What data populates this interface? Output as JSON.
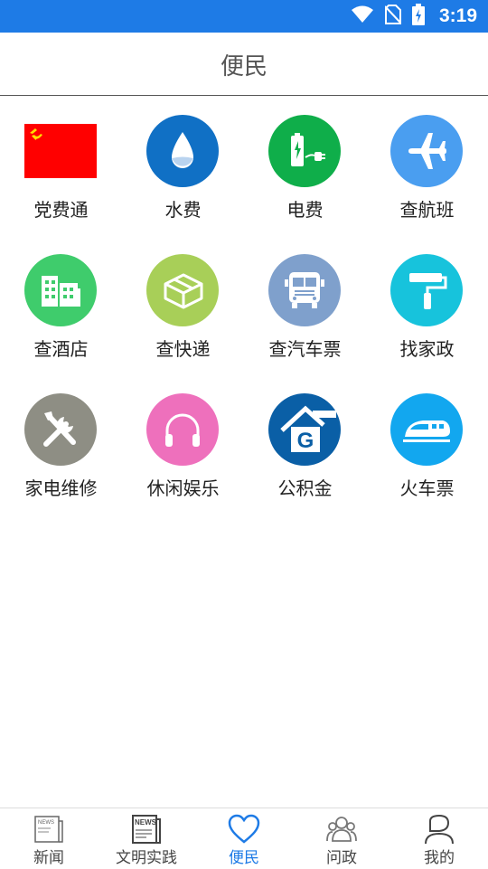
{
  "status_bar": {
    "time": "3:19",
    "background": "#1e7be6"
  },
  "header": {
    "title": "便民"
  },
  "services": [
    {
      "label": "党费通",
      "icon": "party-flag-icon",
      "color": "#ff0000"
    },
    {
      "label": "水费",
      "icon": "water-drop-icon",
      "color": "#1070c5"
    },
    {
      "label": "电费",
      "icon": "battery-plug-icon",
      "color": "#0fae4a"
    },
    {
      "label": "查航班",
      "icon": "airplane-icon",
      "color": "#4a9ef0"
    },
    {
      "label": "查酒店",
      "icon": "hotel-building-icon",
      "color": "#3fcc6c"
    },
    {
      "label": "查快递",
      "icon": "package-box-icon",
      "color": "#a8cf58"
    },
    {
      "label": "查汽车票",
      "icon": "bus-icon",
      "color": "#7fa0cc"
    },
    {
      "label": "找家政",
      "icon": "paint-roller-icon",
      "color": "#17c3dc"
    },
    {
      "label": "家电维修",
      "icon": "repair-tools-icon",
      "color": "#8e8e84"
    },
    {
      "label": "休闲娱乐",
      "icon": "headphones-icon",
      "color": "#ee70bc"
    },
    {
      "label": "公积金",
      "icon": "housing-fund-icon",
      "color": "#0a5fa6"
    },
    {
      "label": "火车票",
      "icon": "high-speed-train-icon",
      "color": "#12a7ef"
    }
  ],
  "tabs": [
    {
      "label": "新闻",
      "icon": "newspaper-icon",
      "active": false
    },
    {
      "label": "文明实践",
      "icon": "news-paper-icon",
      "active": false
    },
    {
      "label": "便民",
      "icon": "heart-icon",
      "active": true
    },
    {
      "label": "问政",
      "icon": "people-group-icon",
      "active": false
    },
    {
      "label": "我的",
      "icon": "user-profile-icon",
      "active": false
    }
  ],
  "accent_color": "#1e7be6"
}
